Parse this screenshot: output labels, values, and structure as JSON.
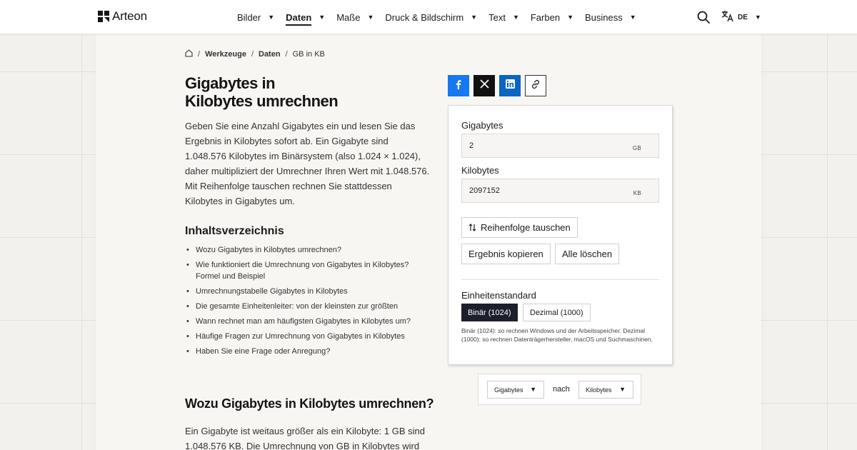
{
  "header": {
    "brand": "Arteon",
    "nav": [
      {
        "label": "Bilder",
        "active": false
      },
      {
        "label": "Daten",
        "active": true
      },
      {
        "label": "Maße",
        "active": false
      },
      {
        "label": "Druck & Bildschirm",
        "active": false
      },
      {
        "label": "Text",
        "active": false
      },
      {
        "label": "Farben",
        "active": false
      },
      {
        "label": "Business",
        "active": false
      }
    ],
    "language": "DE"
  },
  "breadcrumb": {
    "items": [
      "Werkzeuge",
      "Daten"
    ],
    "current": "GB in KB"
  },
  "page": {
    "title_line1": "Gigabytes in",
    "title_line2": "Kilobytes umrechnen",
    "intro": "Geben Sie eine Anzahl Gigabytes ein und lesen Sie das Ergebnis in Kilobytes sofort ab. Ein Gigabyte sind 1.048.576 Kilobytes im Binärsystem (also 1.024 × 1.024), daher multipliziert der Umrechner Ihren Wert mit 1.048.576. Mit Reihenfolge tauschen rechnen Sie stattdessen Kilobytes in Gigabytes um.",
    "toc_title": "Inhaltsverzeichnis",
    "toc": [
      "Wozu Gigabytes in Kilobytes umrechnen?",
      "Wie funktioniert die Umrechnung von Gigabytes in Kilobytes? Formel und Beispiel",
      "Umrechnungstabelle Gigabytes in Kilobytes",
      "Die gesamte Einheitenleiter: von der kleinsten zur größten",
      "Wann rechnet man am häufigsten Gigabytes in Kilobytes um?",
      "Häufige Fragen zur Umrechnung von Gigabytes in Kilobytes",
      "Haben Sie eine Frage oder Anregung?"
    ],
    "section_title": "Wozu Gigabytes in Kilobytes umrechnen?",
    "section_text": "Ein Gigabyte ist weitaus größer als ein Kilobyte: 1 GB sind 1.048.576 KB. Die Umrechnung von GB in Kilobytes wird"
  },
  "converter": {
    "from_label": "Gigabytes",
    "from_value": "2",
    "from_unit": "GB",
    "to_label": "Kilobytes",
    "to_value": "2097152",
    "to_unit": "KB",
    "swap_label": "Reihenfolge tauschen",
    "copy_label": "Ergebnis kopieren",
    "clear_label": "Alle löschen",
    "standard_label": "Einheitenstandard",
    "binary_label": "Binär (1024)",
    "decimal_label": "Dezimal (1000)",
    "note": "Binär (1024): so rechnen Windows und der Arbeitsspeicher. Dezimal (1000): so rechnen Datenträgerhersteller, macOS und Suchmaschinen."
  },
  "unit_selector": {
    "from": "Gigabytes",
    "connector": "nach",
    "to": "Kilobytes"
  },
  "colors": {
    "facebook": "#1877f2",
    "x": "#111111",
    "linkedin": "#0a66c2",
    "active_segment": "#1d1f2b"
  },
  "icons": [
    "home-icon",
    "facebook-icon",
    "x-icon",
    "linkedin-icon",
    "link-icon",
    "swap-icon",
    "search-icon",
    "translate-icon"
  ]
}
